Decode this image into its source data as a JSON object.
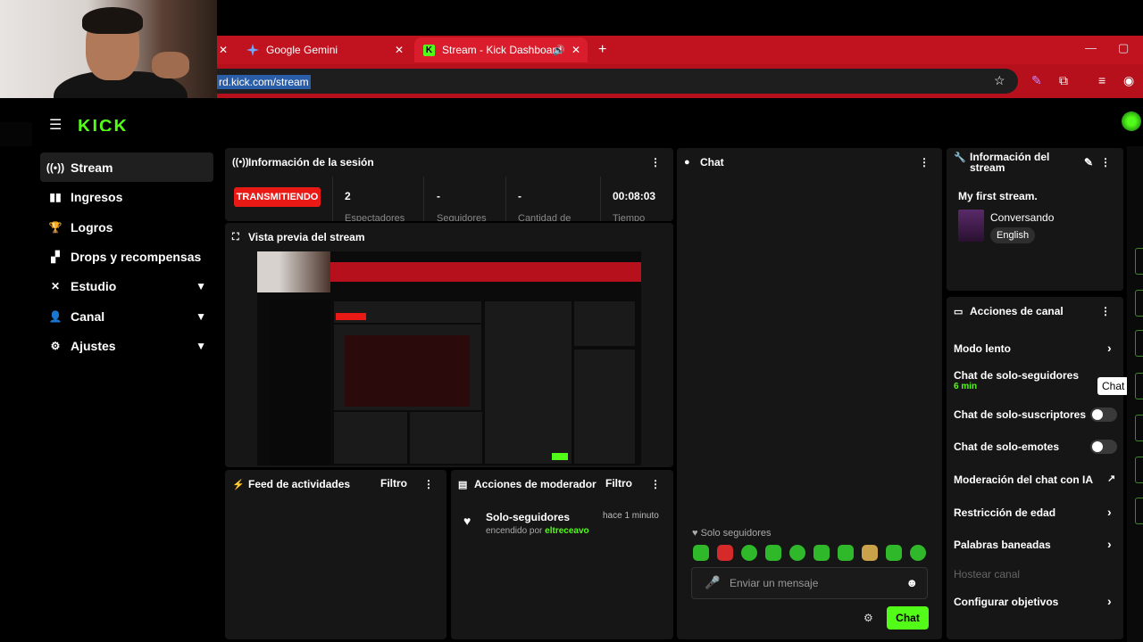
{
  "browser": {
    "tabs": [
      {
        "label": "Google Gemini"
      },
      {
        "label": "Stream - Kick Dashboard"
      }
    ],
    "url": "rd.kick.com/stream"
  },
  "brand": {
    "logo": "KICK",
    "accent": "#53fc18"
  },
  "sidebar": {
    "items": [
      {
        "label": "Stream",
        "icon": "broadcast-icon"
      },
      {
        "label": "Ingresos",
        "icon": "bar-chart-icon"
      },
      {
        "label": "Logros",
        "icon": "trophy-icon"
      },
      {
        "label": "Drops y recompensas",
        "icon": "gift-icon"
      },
      {
        "label": "Estudio",
        "icon": "studio-icon"
      },
      {
        "label": "Canal",
        "icon": "user-icon"
      },
      {
        "label": "Ajustes",
        "icon": "gear-icon"
      }
    ]
  },
  "session": {
    "title": "Información de la sesión",
    "status": "TRANSMITIENDO",
    "stats": [
      {
        "value": "2",
        "label": "Espectadores"
      },
      {
        "value": "-",
        "label": "Seguidores"
      },
      {
        "value": "-",
        "label": "Cantidad de"
      },
      {
        "value": "00:08:03",
        "label": "Tiempo"
      }
    ]
  },
  "preview": {
    "title": "Vista previa del stream"
  },
  "activity": {
    "title": "Feed de actividades",
    "filter": "Filtro"
  },
  "mod": {
    "title": "Acciones de moderador",
    "filter": "Filtro",
    "entry": {
      "title": "Solo-seguidores",
      "sub_prefix": "encendido por",
      "user": "eltreceavo",
      "time": "hace 1 minuto"
    }
  },
  "chat": {
    "title": "Chat",
    "mode_notice": "Solo seguidores",
    "placeholder": "Enviar un mensaje",
    "send": "Chat"
  },
  "stream_info": {
    "title": "Información del stream",
    "stream_title": "My first stream.",
    "category": "Conversando",
    "tag": "English"
  },
  "channel_actions": {
    "title": "Acciones de canal",
    "tooltip": "Chat",
    "items": [
      {
        "label": "Modo lento",
        "type": "arrow"
      },
      {
        "label": "Chat de solo-seguidores",
        "sub": "6 min",
        "type": "arrow"
      },
      {
        "label": "Chat de solo-suscriptores",
        "type": "toggle"
      },
      {
        "label": "Chat de solo-emotes",
        "type": "toggle"
      },
      {
        "label": "Moderación del chat con IA",
        "type": "external"
      },
      {
        "label": "Restricción de edad",
        "type": "arrow"
      },
      {
        "label": "Palabras baneadas",
        "type": "arrow"
      },
      {
        "label": "Hostear canal",
        "type": "disabled"
      },
      {
        "label": "Configurar objetivos",
        "type": "arrow"
      }
    ]
  }
}
